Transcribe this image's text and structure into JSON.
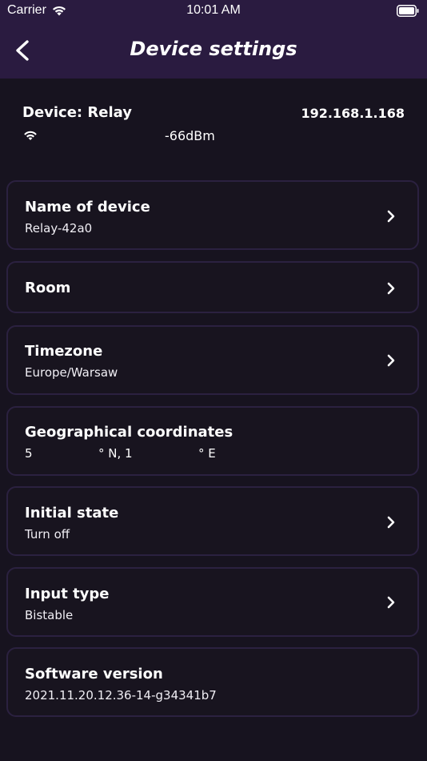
{
  "status_bar": {
    "carrier": "Carrier",
    "time": "10:01 AM"
  },
  "nav": {
    "title": "Device settings",
    "back_icon": "chevron-left-icon"
  },
  "device": {
    "label": "Device:  Relay",
    "ip": "192.168.1.168",
    "signal": "-66dBm",
    "wifi_icon": "wifi-icon"
  },
  "settings": {
    "name": {
      "title": "Name of device",
      "value": "Relay-42a0"
    },
    "room": {
      "title": "Room"
    },
    "timezone": {
      "title": "Timezone",
      "value": "Europe/Warsaw"
    },
    "coordinates": {
      "title": "Geographical coordinates",
      "lat_value": "5",
      "lat_suffix": "° N, 1",
      "lon_suffix": "° E"
    },
    "initial_state": {
      "title": "Initial state",
      "value": "Turn off"
    },
    "input_type": {
      "title": "Input type",
      "value": "Bistable"
    },
    "software": {
      "title": "Software version",
      "value": "2021.11.20.12.36-14-g34341b7"
    }
  },
  "colors": {
    "background": "#17131f",
    "header": "#2a1b40",
    "card_border": "#2b2140"
  }
}
